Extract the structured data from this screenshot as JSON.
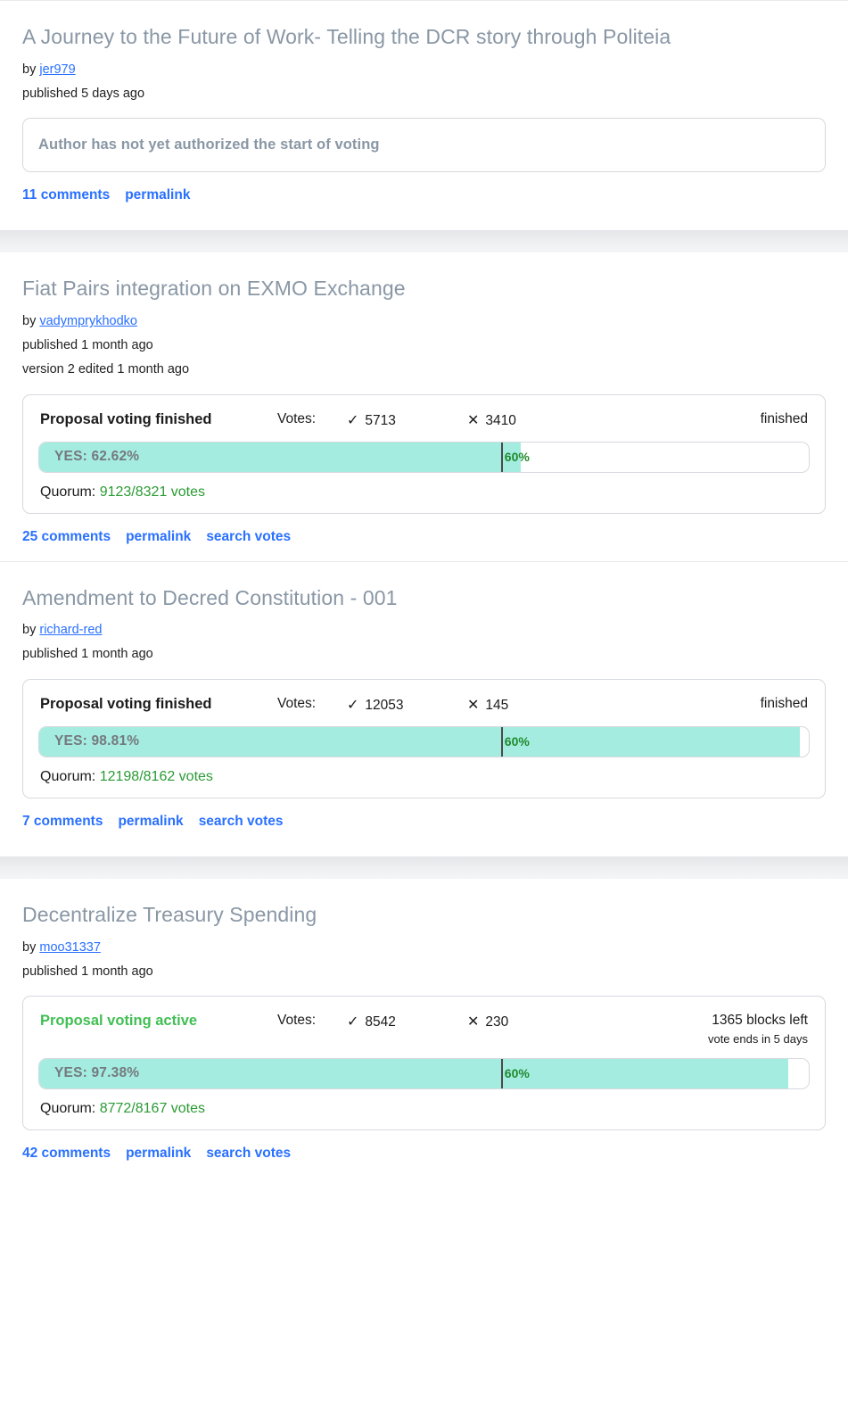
{
  "theme": {
    "accent_link": "#2970ff",
    "title_gray": "#8997a5",
    "bar_fill": "#a5ece0",
    "quorum_green": "#2a9b34",
    "active_green": "#41bf53",
    "threshold_label_green": "#1f8a2d"
  },
  "proposals": [
    {
      "title": "A Journey to the Future of Work- Telling the DCR story through Politeia",
      "by_prefix": "by",
      "author": "jer979",
      "published": "published 5 days ago",
      "version": null,
      "status_kind": "notice",
      "notice": "Author has not yet authorized the start of voting",
      "links": [
        "11 comments",
        "permalink"
      ]
    },
    {
      "title": "Fiat Pairs integration on EXMO Exchange",
      "by_prefix": "by",
      "author": "vadymprykhodko",
      "published": "published 1 month ago",
      "version": "version 2 edited 1 month ago",
      "status_kind": "vote",
      "vote": {
        "status_text": "Proposal voting finished",
        "status_state": "finished",
        "votes_label": "Votes:",
        "yes_mark": "✓",
        "yes_count": "5713",
        "no_mark": "✕",
        "no_count": "3410",
        "right_main": "finished",
        "right_sub": null,
        "bar_label": "YES: 62.62%",
        "percent": 62.62,
        "threshold_percent": 60,
        "threshold_label": "60%",
        "quorum_label": "Quorum:",
        "quorum_value": "9123/8321 votes"
      },
      "links": [
        "25 comments",
        "permalink",
        "search votes"
      ]
    },
    {
      "title": "Amendment to Decred Constitution - 001",
      "by_prefix": "by",
      "author": "richard-red",
      "published": "published 1 month ago",
      "version": null,
      "status_kind": "vote",
      "vote": {
        "status_text": "Proposal voting finished",
        "status_state": "finished",
        "votes_label": "Votes:",
        "yes_mark": "✓",
        "yes_count": "12053",
        "no_mark": "✕",
        "no_count": "145",
        "right_main": "finished",
        "right_sub": null,
        "bar_label": "YES: 98.81%",
        "percent": 98.81,
        "threshold_percent": 60,
        "threshold_label": "60%",
        "quorum_label": "Quorum:",
        "quorum_value": "12198/8162 votes"
      },
      "links": [
        "7 comments",
        "permalink",
        "search votes"
      ]
    },
    {
      "title": "Decentralize Treasury Spending",
      "by_prefix": "by",
      "author": "moo31337",
      "published": "published 1 month ago",
      "version": null,
      "status_kind": "vote",
      "vote": {
        "status_text": "Proposal voting active",
        "status_state": "active",
        "votes_label": "Votes:",
        "yes_mark": "✓",
        "yes_count": "8542",
        "no_mark": "✕",
        "no_count": "230",
        "right_main": "1365 blocks left",
        "right_sub": "vote ends in 5 days",
        "bar_label": "YES: 97.38%",
        "percent": 97.38,
        "threshold_percent": 60,
        "threshold_label": "60%",
        "quorum_label": "Quorum:",
        "quorum_value": "8772/8167 votes"
      },
      "links": [
        "42 comments",
        "permalink",
        "search votes"
      ]
    }
  ]
}
